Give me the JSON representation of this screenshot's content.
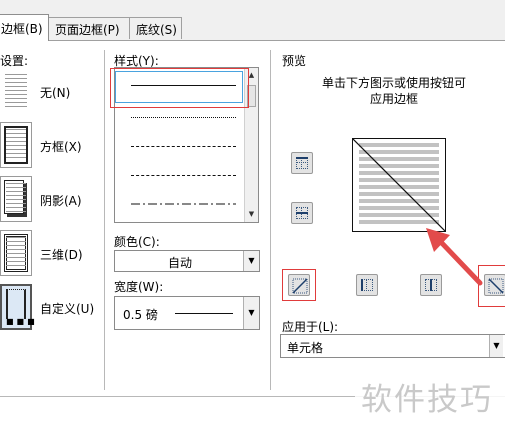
{
  "tabs": [
    {
      "label": "边框(B)",
      "active": true
    },
    {
      "label": "页面边框(P)",
      "active": false
    },
    {
      "label": "底纹(S)",
      "active": false
    }
  ],
  "settings": {
    "heading": "设置:",
    "options": [
      {
        "label": "无(N)",
        "icon": "border-none-icon"
      },
      {
        "label": "方框(X)",
        "icon": "border-box-icon"
      },
      {
        "label": "阴影(A)",
        "icon": "border-shadow-icon"
      },
      {
        "label": "三维(D)",
        "icon": "border-3d-icon"
      },
      {
        "label": "自定义(U)",
        "icon": "border-custom-icon",
        "selected": true
      }
    ]
  },
  "style": {
    "label": "样式(Y):",
    "options": [
      "solid",
      "dotted",
      "dashed",
      "long-dashed",
      "dash-dot"
    ],
    "selected": "solid"
  },
  "color": {
    "label": "颜色(C):",
    "value": "自动"
  },
  "width": {
    "label": "宽度(W):",
    "value": "0.5 磅"
  },
  "preview": {
    "label": "预览",
    "instruction_line1": "单击下方图示或使用按钮可",
    "instruction_line2": "应用边框"
  },
  "apply_to": {
    "label": "应用于(L):",
    "value": "单元格"
  },
  "watermark": "软件技巧",
  "colors": {
    "highlight": "#e03b3b",
    "annotation_arrow": "#e24b4b"
  }
}
